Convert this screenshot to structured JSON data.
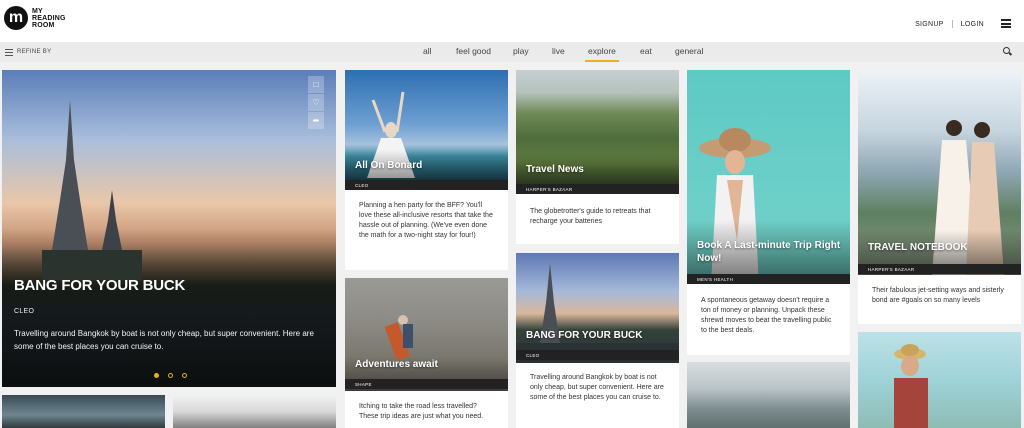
{
  "header": {
    "logo_mark": "m",
    "logo_line1": "MY",
    "logo_line2": "READING",
    "logo_line3": "ROOM",
    "signup": "SIGNUP",
    "login": "LOGIN"
  },
  "nav": {
    "refine_label": "REFINE BY",
    "tabs": [
      "all",
      "feel good",
      "play",
      "live",
      "explore",
      "eat",
      "general"
    ],
    "active_tab": "explore"
  },
  "hero": {
    "title": "BANG FOR YOUR BUCK",
    "source": "CLEO",
    "description": "Travelling around Bangkok by boat is not only cheap, but super convenient. Here are some of the best places you can cruise to."
  },
  "cards": {
    "bonard": {
      "title": "All On Bonard",
      "source": "CLEO",
      "description": "Planning a hen party for the BFF? You'll love these all-inclusive resorts that take the hassle out of planning. (We've even done the math for a two-night stay for four!)"
    },
    "travel_news": {
      "title": "Travel News",
      "source": "HARPER'S BAZAAR",
      "description": "The globetrotter's guide to retreats that recharge your batteries"
    },
    "last_minute": {
      "title": "Book A Last-minute Trip Right Now!",
      "source": "MEN'S HEALTH",
      "description": "A spontaneous getaway doesn't require a ton of money or planning. Unpack these shrewd moves to beat the travelling public to the best deals."
    },
    "notebook": {
      "title": "TRAVEL NOTEBOOK",
      "source": "HARPER'S BAZAAR",
      "description": "Their fabulous jet-setting ways and sisterly bond are #goals on so many levels"
    },
    "adventures": {
      "title": "Adventures await",
      "source": "SHAPE",
      "description": "Itching to take the road less travelled? These trip ideas are just what you need."
    },
    "bangkok2": {
      "title": "BANG FOR YOUR BUCK",
      "source": "CLEO",
      "description": "Travelling around Bangkok by boat is not only cheap, but super convenient. Here are some of the best places you can cruise to."
    }
  },
  "colors": {
    "accent": "#e8b21c"
  }
}
